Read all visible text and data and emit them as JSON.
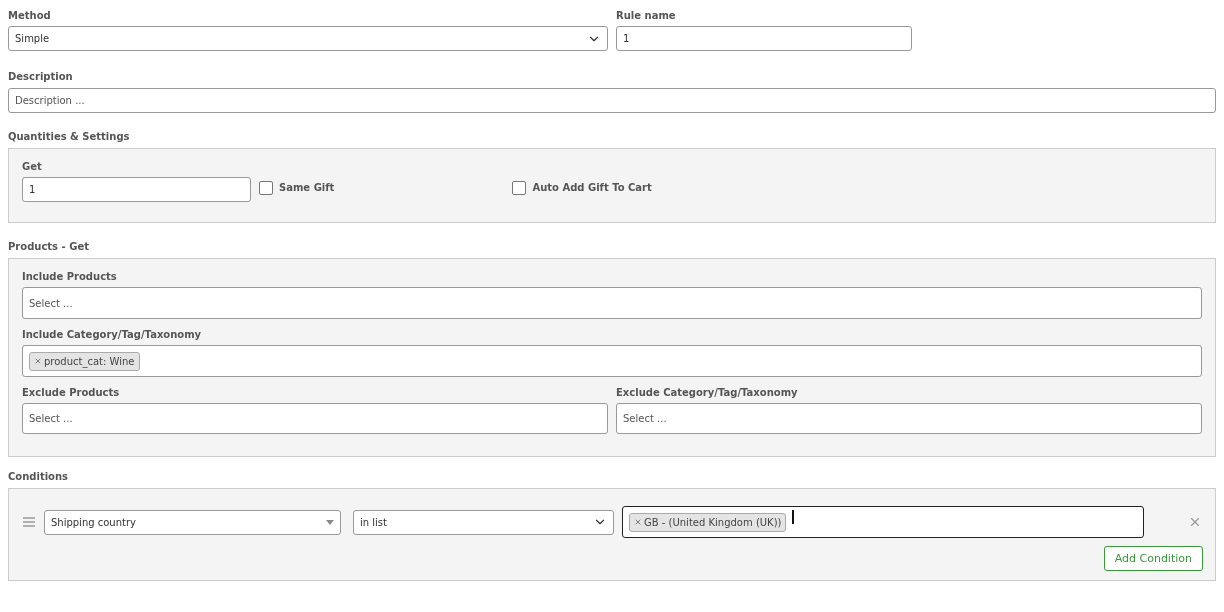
{
  "method": {
    "label": "Method",
    "value": "Simple"
  },
  "rule_name": {
    "label": "Rule name",
    "value": "1"
  },
  "description": {
    "label": "Description",
    "placeholder": "Description ..."
  },
  "quantities": {
    "title": "Quantities & Settings",
    "get": {
      "label": "Get",
      "value": "1"
    },
    "checkboxes": [
      {
        "label": "Same Gift",
        "checked": false
      },
      {
        "label": "Auto Add Gift To Cart",
        "checked": false
      }
    ]
  },
  "products": {
    "title": "Products - Get",
    "include_products": {
      "label": "Include Products",
      "placeholder": "Select ..."
    },
    "include_category": {
      "label": "Include Category/Tag/Taxonomy",
      "tags": [
        "product_cat: Wine"
      ]
    },
    "exclude_products": {
      "label": "Exclude Products",
      "placeholder": "Select ..."
    },
    "exclude_category": {
      "label": "Exclude Category/Tag/Taxonomy",
      "placeholder": "Select ..."
    }
  },
  "conditions": {
    "title": "Conditions",
    "rows": [
      {
        "type": "Shipping country",
        "operator": "in list",
        "tags": [
          "GB - (United Kingdom (UK))"
        ],
        "focused": true
      }
    ],
    "add_button": "Add Condition"
  }
}
